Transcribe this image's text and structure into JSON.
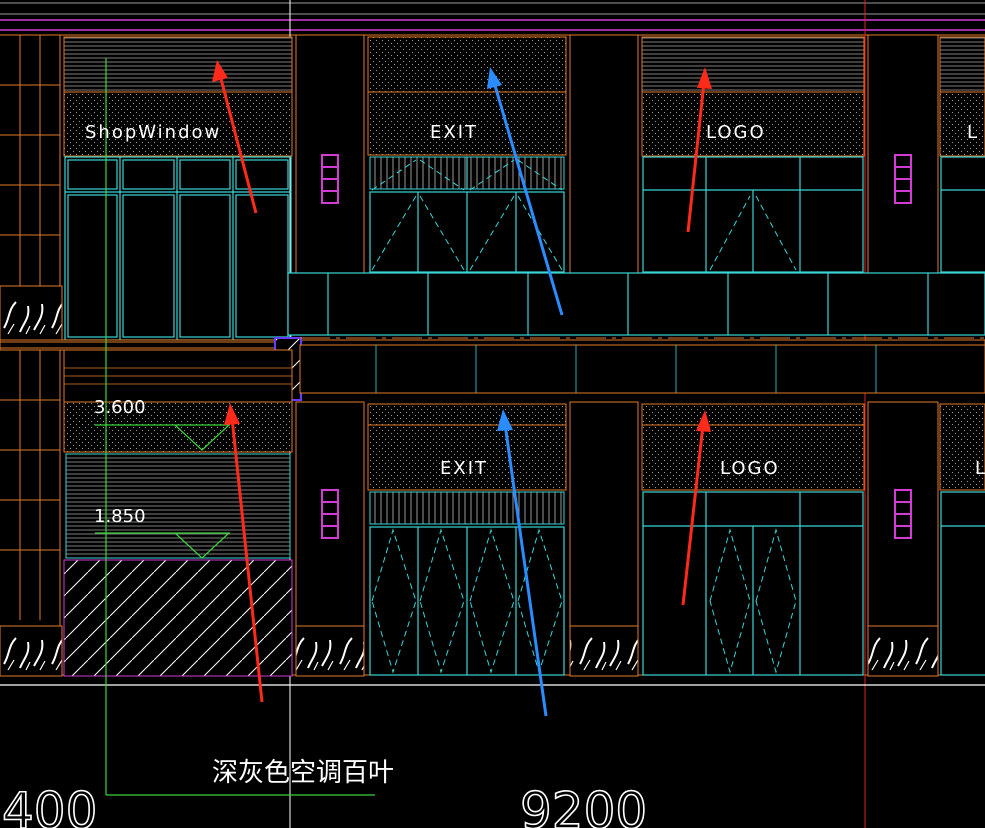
{
  "labels": {
    "shop_window": "ShopWindow",
    "exit_upper": "EXIT",
    "logo_upper": "LOGO",
    "logo_upper_right_partial": "L",
    "exit_lower": "EXIT",
    "logo_lower": "LOGO",
    "logo_lower_right_partial": "L"
  },
  "elevations": {
    "upper": "3.600",
    "lower": "1.850"
  },
  "note": "深灰色空调百叶",
  "dimensions": {
    "left": "400",
    "center": "9200"
  },
  "colors": {
    "background": "#000000",
    "frame_orange": "#e07a2a",
    "glass_cyan": "#38d6d6",
    "band_magenta": "#d23cd2",
    "arrow_red": "#ff2a1a",
    "arrow_blue": "#2a8cff",
    "line_white": "#ffffff",
    "axis_green": "#3bd23b",
    "trim_purple": "#6a3cff"
  }
}
